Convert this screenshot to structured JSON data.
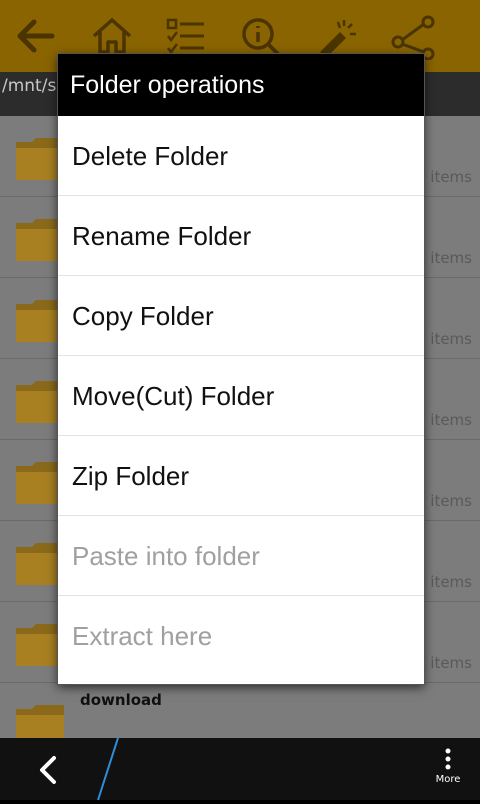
{
  "toolbar": {
    "icons": [
      "back-arrow-icon",
      "home-icon",
      "checklist-icon",
      "info-icon",
      "flashlight-icon",
      "share-icon"
    ]
  },
  "path": "/mnt/s",
  "files": [
    {
      "count": "items"
    },
    {
      "count": "items"
    },
    {
      "count": "items"
    },
    {
      "count": "items"
    },
    {
      "count": "items"
    },
    {
      "count": "items"
    },
    {
      "count": "items"
    },
    {
      "name": "download"
    }
  ],
  "dialog": {
    "title": "Folder operations",
    "items": [
      {
        "label": "Delete Folder",
        "enabled": true
      },
      {
        "label": "Rename Folder",
        "enabled": true
      },
      {
        "label": "Copy Folder",
        "enabled": true
      },
      {
        "label": "Move(Cut) Folder",
        "enabled": true
      },
      {
        "label": "Zip Folder",
        "enabled": true
      },
      {
        "label": "Paste into folder",
        "enabled": false
      },
      {
        "label": "Extract here",
        "enabled": false
      }
    ]
  },
  "navbar": {
    "more_label": "More"
  },
  "colors": {
    "toolbar_bg": "#8a6400",
    "folder": "#e8a516",
    "dialog_title_bg": "#000000",
    "disabled_text": "#a0a0a0"
  }
}
